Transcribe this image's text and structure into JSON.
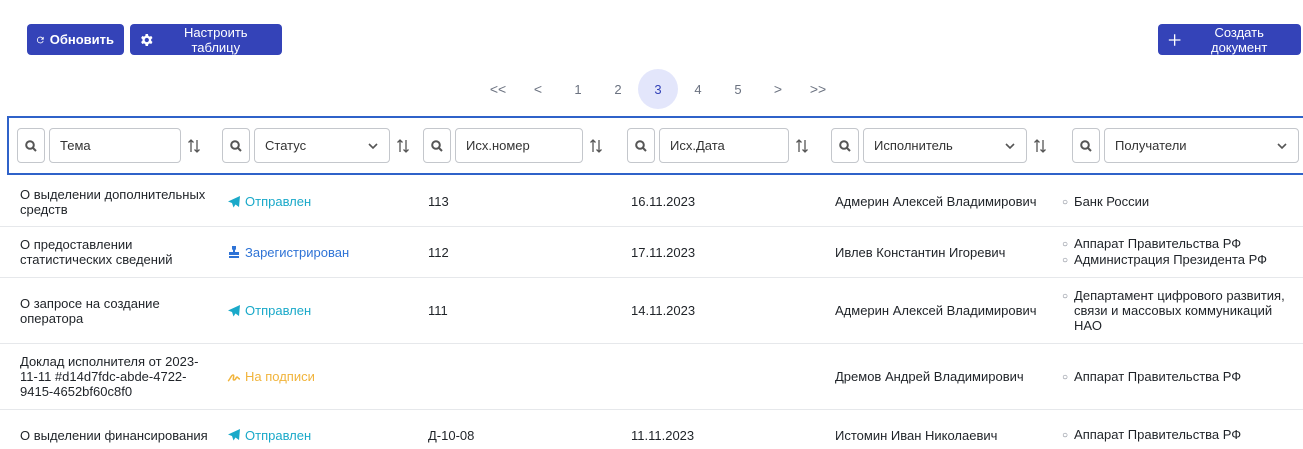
{
  "toolbar": {
    "refresh_label": "Обновить",
    "settings_label": "Настроить таблицу",
    "create_label": "Создать документ"
  },
  "pager": {
    "first": "<<",
    "prev": "<",
    "pages": [
      "1",
      "2",
      "3",
      "4",
      "5"
    ],
    "current": "3",
    "next": ">",
    "last": ">>"
  },
  "filters": {
    "theme": "Тема",
    "status": "Статус",
    "out_number": "Исх.номер",
    "out_date": "Исх.Дата",
    "executor": "Исполнитель",
    "recipients": "Получатели"
  },
  "colors": {
    "primary": "#3443b8",
    "sent": "#1aa9c9",
    "registered": "#2e73d6",
    "signing": "#f1b43b",
    "focus_border": "#2f62c9"
  },
  "rows": [
    {
      "theme": "О выделении дополнительных средств",
      "status": "Отправлен",
      "status_icon": "paper-plane-icon",
      "number": "113",
      "date": "16.11.2023",
      "executor": "Адмерин Алексей Владимирович",
      "recipients": [
        "Банк России"
      ]
    },
    {
      "theme": "О предоставлении статистических сведений",
      "status": "Зарегистрирован",
      "status_icon": "stamp-icon",
      "number": "112",
      "date": "17.11.2023",
      "executor": "Ивлев Константин Игоревич",
      "recipients": [
        "Аппарат Правительства РФ",
        "Администрация Президента РФ"
      ]
    },
    {
      "theme": "О запросе на создание оператора",
      "status": "Отправлен",
      "status_icon": "paper-plane-icon",
      "number": "111",
      "date": "14.11.2023",
      "executor": "Адмерин Алексей Владимирович",
      "recipients": [
        "Департамент цифрового развития, связи и массовых коммуникаций НАО"
      ]
    },
    {
      "theme": "Доклад исполнителя от 2023-11-11 #d14d7fdc-abde-4722-9415-4652bf60c8f0",
      "status": "На подписи",
      "status_icon": "signature-icon",
      "number": "",
      "date": "",
      "executor": "Дремов Андрей Владимирович",
      "recipients": [
        "Аппарат Правительства РФ"
      ]
    },
    {
      "theme": "О выделении финансирования",
      "status": "Отправлен",
      "status_icon": "paper-plane-icon",
      "number": "Д-10-08",
      "date": "11.11.2023",
      "executor": "Истомин Иван Николаевич",
      "recipients": [
        "Аппарат Правительства РФ"
      ]
    }
  ]
}
